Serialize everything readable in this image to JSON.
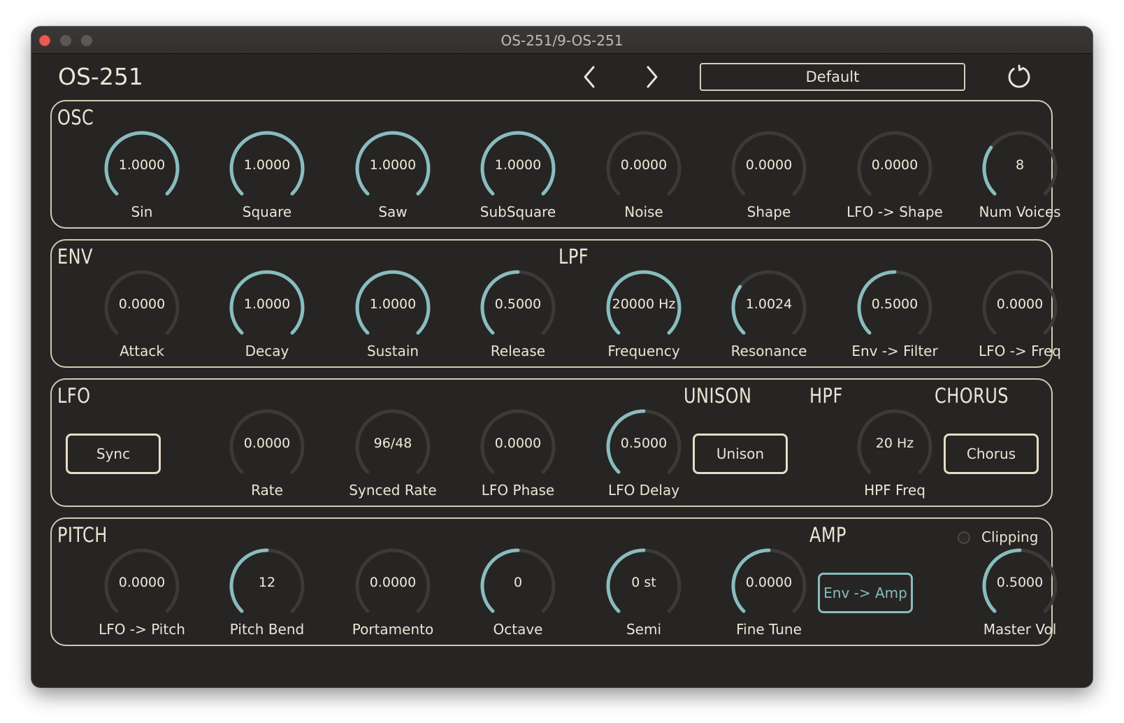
{
  "window": {
    "title": "OS-251/9-OS-251"
  },
  "header": {
    "app_title": "OS-251",
    "preset": "Default"
  },
  "colors": {
    "accent": "#89bcbe",
    "track": "#3b3a37",
    "panel_border": "#d4c8b2",
    "background": "#262523",
    "text": "#ece4d6"
  },
  "panels": {
    "osc": {
      "title": "OSC",
      "knobs": [
        {
          "value": "1.0000",
          "label": "Sin",
          "level": 1.0
        },
        {
          "value": "1.0000",
          "label": "Square",
          "level": 1.0
        },
        {
          "value": "1.0000",
          "label": "Saw",
          "level": 1.0
        },
        {
          "value": "1.0000",
          "label": "SubSquare",
          "level": 1.0
        },
        {
          "value": "0.0000",
          "label": "Noise",
          "level": 0.0
        },
        {
          "value": "0.0000",
          "label": "Shape",
          "level": 0.0
        },
        {
          "value": "0.0000",
          "label": "LFO -> Shape",
          "level": 0.0
        },
        {
          "value": "8",
          "label": "Num Voices",
          "level": 0.3
        }
      ]
    },
    "env": {
      "title": "ENV",
      "lpf_title": "LPF",
      "knobs": [
        {
          "value": "0.0000",
          "label": "Attack",
          "level": 0.0
        },
        {
          "value": "1.0000",
          "label": "Decay",
          "level": 1.0
        },
        {
          "value": "1.0000",
          "label": "Sustain",
          "level": 1.0
        },
        {
          "value": "0.5000",
          "label": "Release",
          "level": 0.5
        },
        {
          "value": "20000 Hz",
          "label": "Frequency",
          "level": 1.0
        },
        {
          "value": "1.0024",
          "label": "Resonance",
          "level": 0.3
        },
        {
          "value": "0.5000",
          "label": "Env -> Filter",
          "level": 0.5
        },
        {
          "value": "0.0000",
          "label": "LFO -> Freq",
          "level": 0.0
        }
      ]
    },
    "lfo": {
      "title": "LFO",
      "unison_title": "UNISON",
      "hpf_title": "HPF",
      "chorus_title": "CHORUS",
      "sync_label": "Sync",
      "unison_label": "Unison",
      "chorus_label": "Chorus",
      "knobs": [
        {
          "value": "0.0000",
          "label": "Rate",
          "level": 0.0
        },
        {
          "value": "96/48",
          "label": "Synced Rate",
          "level": 0.0
        },
        {
          "value": "0.0000",
          "label": "LFO Phase",
          "level": 0.0
        },
        {
          "value": "0.5000",
          "label": "LFO Delay",
          "level": 0.5
        },
        {
          "value": "20 Hz",
          "label": "HPF Freq",
          "level": 0.0
        }
      ]
    },
    "pitch": {
      "title": "PITCH",
      "amp_title": "AMP",
      "env_amp_label": "Env -> Amp",
      "clipping_label": "Clipping",
      "knobs": [
        {
          "value": "0.0000",
          "label": "LFO -> Pitch",
          "level": 0.0
        },
        {
          "value": "12",
          "label": "Pitch Bend",
          "level": 0.5
        },
        {
          "value": "0.0000",
          "label": "Portamento",
          "level": 0.0
        },
        {
          "value": "0",
          "label": "Octave",
          "level": 0.5
        },
        {
          "value": "0 st",
          "label": "Semi",
          "level": 0.5
        },
        {
          "value": "0.0000",
          "label": "Fine Tune",
          "level": 0.5
        },
        {
          "value": "0.5000",
          "label": "Master Vol",
          "level": 0.5
        }
      ]
    }
  }
}
